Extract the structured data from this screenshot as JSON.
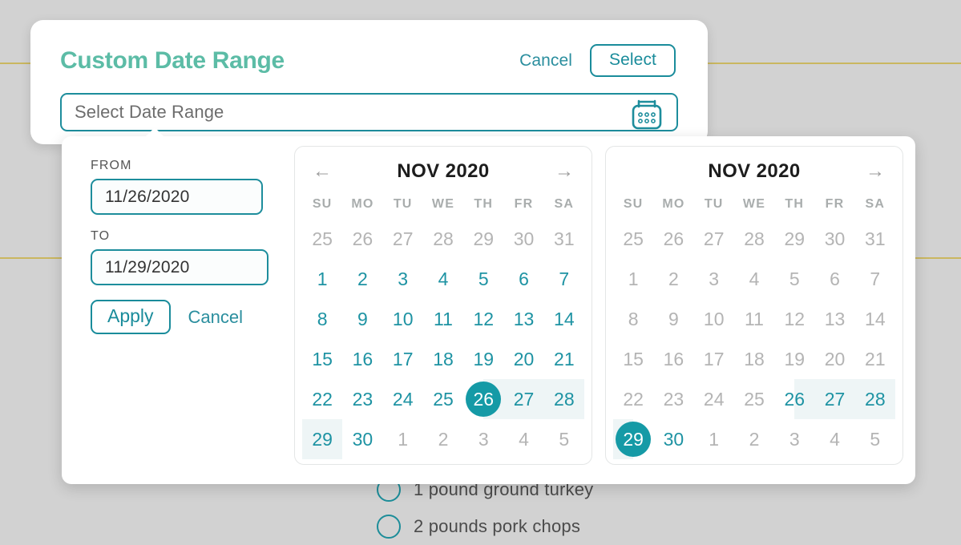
{
  "background": {
    "items": [
      {
        "text": "1 pound  ground turkey"
      },
      {
        "text": "2 pounds  pork chops"
      }
    ]
  },
  "modal": {
    "title": "Custom Date Range",
    "cancel_label": "Cancel",
    "select_label": "Select",
    "input": {
      "placeholder": "Select Date Range",
      "value": "",
      "icon": "calendar-icon"
    }
  },
  "popup": {
    "from_label": "FROM",
    "from_value": "11/26/2020",
    "to_label": "TO",
    "to_value": "11/29/2020",
    "apply_label": "Apply",
    "cancel_label": "Cancel",
    "weekdays": [
      "SU",
      "MO",
      "TU",
      "WE",
      "TH",
      "FR",
      "SA"
    ],
    "calendars": [
      {
        "title": "NOV 2020",
        "prev_icon": "arrow-left-icon",
        "next_icon": "arrow-right-icon",
        "show_prev": true,
        "show_next": true,
        "weeks": [
          [
            {
              "d": "25",
              "s": "muted"
            },
            {
              "d": "26",
              "s": "muted"
            },
            {
              "d": "27",
              "s": "muted"
            },
            {
              "d": "28",
              "s": "muted"
            },
            {
              "d": "29",
              "s": "muted"
            },
            {
              "d": "30",
              "s": "muted"
            },
            {
              "d": "31",
              "s": "muted"
            }
          ],
          [
            {
              "d": "1",
              "s": ""
            },
            {
              "d": "2",
              "s": ""
            },
            {
              "d": "3",
              "s": ""
            },
            {
              "d": "4",
              "s": ""
            },
            {
              "d": "5",
              "s": ""
            },
            {
              "d": "6",
              "s": ""
            },
            {
              "d": "7",
              "s": ""
            }
          ],
          [
            {
              "d": "8",
              "s": ""
            },
            {
              "d": "9",
              "s": ""
            },
            {
              "d": "10",
              "s": ""
            },
            {
              "d": "11",
              "s": ""
            },
            {
              "d": "12",
              "s": ""
            },
            {
              "d": "13",
              "s": ""
            },
            {
              "d": "14",
              "s": ""
            }
          ],
          [
            {
              "d": "15",
              "s": ""
            },
            {
              "d": "16",
              "s": ""
            },
            {
              "d": "17",
              "s": ""
            },
            {
              "d": "18",
              "s": ""
            },
            {
              "d": "19",
              "s": ""
            },
            {
              "d": "20",
              "s": ""
            },
            {
              "d": "21",
              "s": ""
            }
          ],
          [
            {
              "d": "22",
              "s": ""
            },
            {
              "d": "23",
              "s": ""
            },
            {
              "d": "24",
              "s": ""
            },
            {
              "d": "25",
              "s": ""
            },
            {
              "d": "26",
              "s": "selected range-start"
            },
            {
              "d": "27",
              "s": "inrange"
            },
            {
              "d": "28",
              "s": "inrange"
            }
          ],
          [
            {
              "d": "29",
              "s": "inrange"
            },
            {
              "d": "30",
              "s": ""
            },
            {
              "d": "1",
              "s": "muted"
            },
            {
              "d": "2",
              "s": "muted"
            },
            {
              "d": "3",
              "s": "muted"
            },
            {
              "d": "4",
              "s": "muted"
            },
            {
              "d": "5",
              "s": "muted"
            }
          ]
        ]
      },
      {
        "title": "NOV 2020",
        "prev_icon": "arrow-left-icon",
        "next_icon": "arrow-right-icon",
        "show_prev": false,
        "show_next": true,
        "weeks": [
          [
            {
              "d": "25",
              "s": "disabled"
            },
            {
              "d": "26",
              "s": "disabled"
            },
            {
              "d": "27",
              "s": "disabled"
            },
            {
              "d": "28",
              "s": "disabled"
            },
            {
              "d": "29",
              "s": "disabled"
            },
            {
              "d": "30",
              "s": "disabled"
            },
            {
              "d": "31",
              "s": "disabled"
            }
          ],
          [
            {
              "d": "1",
              "s": "disabled"
            },
            {
              "d": "2",
              "s": "disabled"
            },
            {
              "d": "3",
              "s": "disabled"
            },
            {
              "d": "4",
              "s": "disabled"
            },
            {
              "d": "5",
              "s": "disabled"
            },
            {
              "d": "6",
              "s": "disabled"
            },
            {
              "d": "7",
              "s": "disabled"
            }
          ],
          [
            {
              "d": "8",
              "s": "disabled"
            },
            {
              "d": "9",
              "s": "disabled"
            },
            {
              "d": "10",
              "s": "disabled"
            },
            {
              "d": "11",
              "s": "disabled"
            },
            {
              "d": "12",
              "s": "disabled"
            },
            {
              "d": "13",
              "s": "disabled"
            },
            {
              "d": "14",
              "s": "disabled"
            }
          ],
          [
            {
              "d": "15",
              "s": "disabled"
            },
            {
              "d": "16",
              "s": "disabled"
            },
            {
              "d": "17",
              "s": "disabled"
            },
            {
              "d": "18",
              "s": "disabled"
            },
            {
              "d": "19",
              "s": "disabled"
            },
            {
              "d": "20",
              "s": "disabled"
            },
            {
              "d": "21",
              "s": "disabled"
            }
          ],
          [
            {
              "d": "22",
              "s": "disabled"
            },
            {
              "d": "23",
              "s": "disabled"
            },
            {
              "d": "24",
              "s": "disabled"
            },
            {
              "d": "25",
              "s": "disabled"
            },
            {
              "d": "26",
              "s": "inrange range-start"
            },
            {
              "d": "27",
              "s": "inrange"
            },
            {
              "d": "28",
              "s": "inrange"
            }
          ],
          [
            {
              "d": "29",
              "s": "selected range-end"
            },
            {
              "d": "30",
              "s": ""
            },
            {
              "d": "1",
              "s": "disabled"
            },
            {
              "d": "2",
              "s": "disabled"
            },
            {
              "d": "3",
              "s": "disabled"
            },
            {
              "d": "4",
              "s": "disabled"
            },
            {
              "d": "5",
              "s": "disabled"
            }
          ]
        ]
      }
    ]
  },
  "colors": {
    "teal": "#1a8c9b",
    "teal_fill": "#159aa6",
    "title_green": "#5cbca6",
    "range_bg": "#eef5f6",
    "muted": "#b4b4b4",
    "page_bg": "#d2d2d2",
    "rule_gold": "#c7ad3a"
  }
}
